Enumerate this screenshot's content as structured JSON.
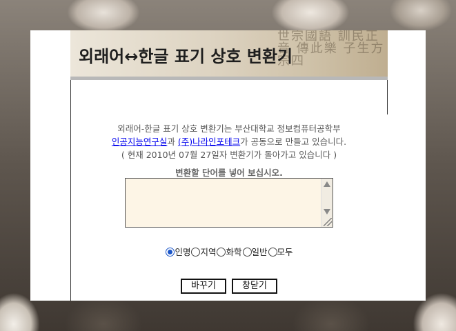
{
  "banner": {
    "title": "외래어↔한글 표기 상호 변환기",
    "decor_text": "世宗國語 訓民正音 傳此樂 子生方 宗四"
  },
  "info": {
    "line1": "외래어-한글 표기 상호 변환기는 부산대학교 정보컴퓨터공학부",
    "link1": "인공지능연구실",
    "mid": "과 ",
    "link2": "(주)나라인포테크",
    "line2_rest": "가 공동으로 만들고 있습니다.",
    "line3": "( 현재 2010년 07월 27일자 변환기가 돌아가고 있습니다 )"
  },
  "input": {
    "prompt": "변환할 단어를 넣어 보십시오.",
    "value": ""
  },
  "options": {
    "selected": "인명",
    "items": [
      "인명",
      "지역",
      "화학",
      "일반",
      "모두"
    ]
  },
  "buttons": {
    "convert": "바꾸기",
    "close": "창닫기"
  },
  "colors": {
    "link": "#0000ee",
    "textarea_bg": "#fdf5e6",
    "radio_selected": "#1a55c8"
  }
}
